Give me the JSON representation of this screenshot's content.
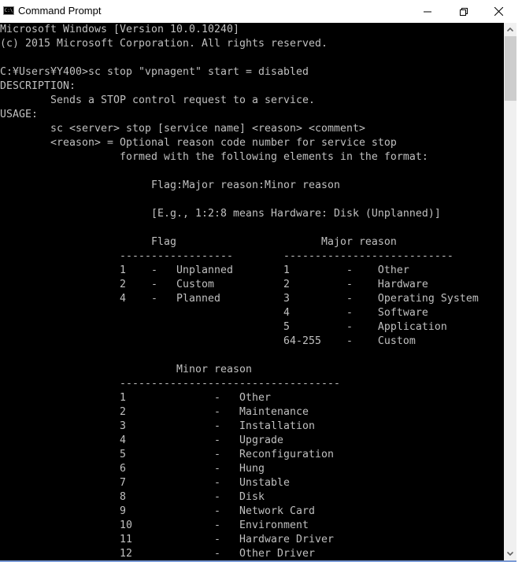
{
  "window": {
    "title": "Command Prompt",
    "app_icon": "cmd-icon",
    "app_icon_text": "C:\\",
    "controls": {
      "minimize": "minimize-icon",
      "restore": "restore-icon",
      "close": "close-icon"
    }
  },
  "console": {
    "lines": [
      "Microsoft Windows [Version 10.0.10240]",
      "(c) 2015 Microsoft Corporation. All rights reserved.",
      "",
      "C:¥Users¥Y400>sc stop \"vpnagent\" start = disabled",
      "DESCRIPTION:",
      "        Sends a STOP control request to a service.",
      "USAGE:",
      "        sc <server> stop [service name] <reason> <comment>",
      "        <reason> = Optional reason code number for service stop",
      "                   formed with the following elements in the format:",
      "",
      "                        Flag:Major reason:Minor reason",
      "",
      "                        [E.g., 1:2:8 means Hardware: Disk (Unplanned)]",
      "",
      "                        Flag                       Major reason",
      "                   ------------------        ---------------------------",
      "                   1    -   Unplanned        1         -    Other",
      "                   2    -   Custom           2         -    Hardware",
      "                   4    -   Planned          3         -    Operating System",
      "                                             4         -    Software",
      "                                             5         -    Application",
      "                                             64-255    -    Custom",
      "",
      "                            Minor reason",
      "                   -----------------------------------",
      "                   1              -   Other",
      "                   2              -   Maintenance",
      "                   3              -   Installation",
      "                   4              -   Upgrade",
      "                   5              -   Reconfiguration",
      "                   6              -   Hung",
      "                   7              -   Unstable",
      "                   8              -   Disk",
      "                   9              -   Network Card",
      "                   10             -   Environment",
      "                   11             -   Hardware Driver",
      "                   12             -   Other Driver"
    ]
  },
  "scrollbar": {
    "up_icon": "chevron-up-icon",
    "down_icon": "chevron-down-icon"
  },
  "colors": {
    "console_bg": "#000000",
    "console_fg": "#c0c0c0",
    "scrollbar_track": "#f0f0f0",
    "scrollbar_thumb": "#cdcdcd",
    "window_border_accent": "#7a9bd6"
  }
}
